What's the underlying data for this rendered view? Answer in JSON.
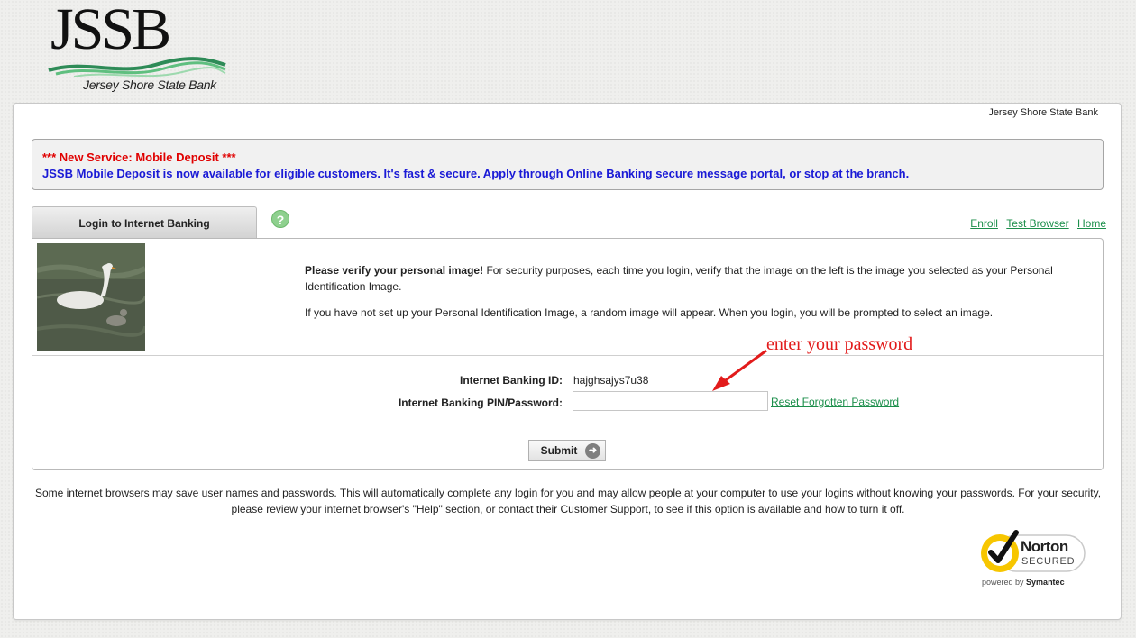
{
  "logo": {
    "letters": "JSSB",
    "bank_name": "Jersey Shore State Bank"
  },
  "header": {
    "bank_name": "Jersey Shore State Bank"
  },
  "notice": {
    "title": "*** New Service: Mobile Deposit ***",
    "body": "JSSB Mobile Deposit is now available for eligible customers. It's fast & secure. Apply through Online Banking secure message portal, or stop at the branch.",
    "title_color": "#e00000",
    "body_color": "#1a1ad6"
  },
  "tab": {
    "label": "Login to Internet Banking",
    "help_icon": "question-icon",
    "help_glyph": "?"
  },
  "links": {
    "enroll": "Enroll",
    "test_browser": "Test Browser",
    "home": "Home",
    "link_color": "#1c8f4b"
  },
  "verify": {
    "heading": "Please verify your personal image!",
    "text1": "For security purposes, each time you login, verify that the image on the left is the image you selected as your Personal Identification Image.",
    "text2": "If you have not set up your Personal Identification Image, a random image will appear. When you login, you will be prompted to select an image."
  },
  "form": {
    "id_label": "Internet Banking ID:",
    "id_value": "hajghsajys7u38",
    "pin_label": "Internet Banking PIN/Password:",
    "pin_value": "",
    "reset_link": "Reset Forgotten Password",
    "submit_label": "Submit"
  },
  "annotation": {
    "text": "enter your password",
    "color": "#e21b1b"
  },
  "disclaimer": {
    "text": "Some internet browsers may save user names and passwords. This will automatically complete any login for you and may allow people at your computer to use your logins without knowing your passwords. For your security, please review your internet browser's \"Help\" section, or contact their Customer Support, to see if this option is available and how to turn it off."
  },
  "norton": {
    "name": "Norton",
    "secured": "SECURED",
    "powered_prefix": "powered by",
    "powered_brand": "Symantec"
  }
}
